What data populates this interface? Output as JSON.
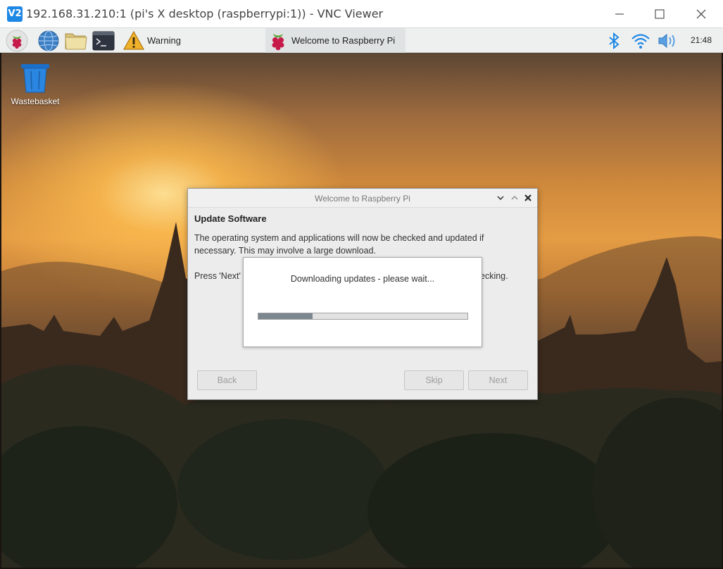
{
  "vnc_window": {
    "logo": "V2",
    "title": "192.168.31.210:1 (pi's X desktop (raspberrypi:1)) - VNC Viewer",
    "controls": [
      "minimize-icon",
      "maximize-icon",
      "close-icon"
    ]
  },
  "taskbar": {
    "launchers": [
      "raspberry-menu-icon",
      "web-browser-icon",
      "file-manager-icon",
      "terminal-icon"
    ],
    "tasks": [
      {
        "label": "Warning",
        "icon": "warning-icon"
      },
      {
        "label": "Welcome to Raspberry Pi",
        "icon": "raspberry-icon"
      }
    ],
    "tray": [
      "bluetooth-icon",
      "wifi-icon",
      "volume-icon"
    ],
    "clock": "21:48"
  },
  "desktop": {
    "icons": [
      {
        "label": "Wastebasket",
        "icon": "wastebasket-icon"
      }
    ]
  },
  "wizard": {
    "title": "Welcome to Raspberry Pi",
    "heading": "Update Software",
    "body_line1": "The operating system and applications will now be checked and updated if",
    "body_line2": "necessary. This may involve a large download.",
    "press_prefix": "Press 'Next' t",
    "press_suffix": "ecking.",
    "buttons": {
      "back": "Back",
      "skip": "Skip",
      "next": "Next"
    }
  },
  "progress_dialog": {
    "message": "Downloading updates - please wait...",
    "progress": 0.26
  },
  "colors": {
    "vnc_logo": "#1e88e5",
    "bluetooth": "#1e88e5",
    "progress_fill": "#7c868e",
    "warning": "#e8a317"
  }
}
